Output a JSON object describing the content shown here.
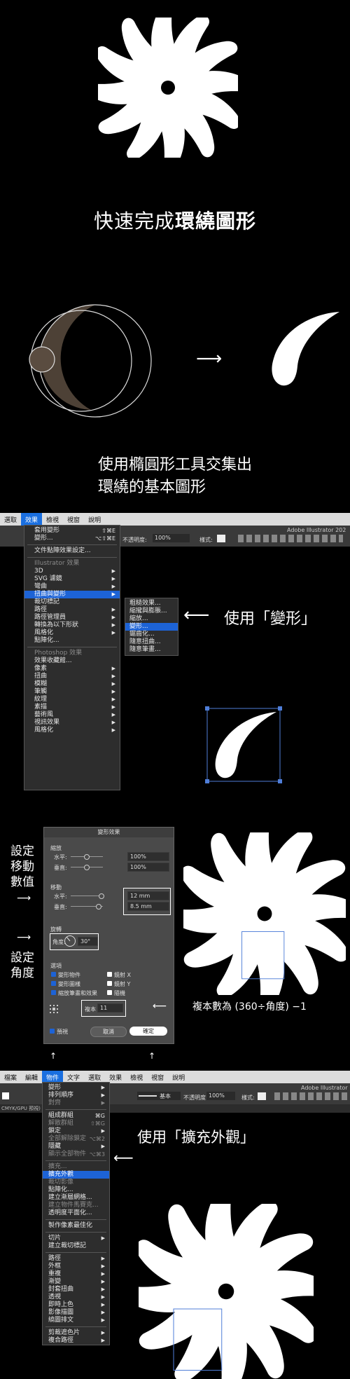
{
  "colors": {
    "accent": "#1d63d6",
    "bg": "#000000",
    "menubar": "#dcdcdc",
    "panel": "#2d2d2d"
  },
  "section1": {
    "title_regular": "快速完成",
    "title_bold": "環繞圖形"
  },
  "section2": {
    "caption_line1": "使用橢圓形工具交集出",
    "caption_line2": "環繞的基本圖形",
    "arrow": "⟶"
  },
  "section3": {
    "menubar": [
      "選取",
      "效果",
      "檢視",
      "視窗",
      "說明"
    ],
    "active_menu": "效果",
    "app_title": "Adobe Illustrator 202",
    "opacity_label": "不透明度:",
    "opacity_value": "100%",
    "style_label": "樣式:",
    "effect_menu_top": [
      {
        "label": "套用變形",
        "shortcut": "⇧⌘E"
      },
      {
        "label": "變形...",
        "shortcut": "⌥⇧⌘E"
      }
    ],
    "doc_raster": "文件點陣效果設定...",
    "illustrator_header": "Illustrator 效果",
    "illustrator_items": [
      "3D",
      "SVG 濾鏡",
      "彎曲",
      "扭曲與變形",
      "裁切標記",
      "路徑",
      "路徑管理員",
      "轉換為以下形狀",
      "風格化",
      "點陣化..."
    ],
    "photoshop_header": "Photoshop 效果",
    "photoshop_items": [
      "效果收藏館...",
      "像素",
      "扭曲",
      "模糊",
      "筆觸",
      "紋理",
      "素描",
      "藝術風",
      "視訊效果",
      "風格化"
    ],
    "submenu": [
      "粗糙效果...",
      "縮攏與膨脹...",
      "縮放...",
      "變形...",
      "鋸齒化...",
      "隨意扭曲...",
      "隨意筆畫..."
    ],
    "submenu_selected": "變形...",
    "callout": "使用「變形」"
  },
  "section4": {
    "left_label1": [
      "設定",
      "移動",
      "數值"
    ],
    "left_label2": [
      "設定",
      "角度"
    ],
    "dialog_title": "變形效果",
    "scale_header": "縮放",
    "scale_h_label": "水平:",
    "scale_h_value": "100%",
    "scale_v_label": "垂直:",
    "scale_v_value": "100%",
    "move_header": "移動",
    "move_h_label": "水平:",
    "move_h_value": "12 mm",
    "move_v_label": "垂直:",
    "move_v_value": "8.5 mm",
    "rotate_header": "旋轉",
    "angle_label": "角度:",
    "angle_value": "30°",
    "options_header": "選項",
    "options": [
      "變形物件",
      "變形圖樣",
      "縮放筆畫和效果"
    ],
    "options_right": [
      "鏡射 X",
      "鏡射 Y",
      "隨機"
    ],
    "copies_label": "複本",
    "copies_value": "11",
    "preview_label": "預視",
    "cancel": "取消",
    "ok": "確定",
    "copies_note": "複本數為 (360÷角度) −1"
  },
  "section5": {
    "menubar": [
      "檔案",
      "編輯",
      "物件",
      "文字",
      "選取",
      "效果",
      "檢視",
      "視窗",
      "說明"
    ],
    "active_menu": "物件",
    "app_title": "Adobe Illustrator",
    "doc_tab": "CMYK/GPU 預視)",
    "stroke_label": "基本",
    "opacity_label": "不透明度:",
    "opacity_value": "100%",
    "style_label": "樣式:",
    "object_menu": [
      {
        "label": "變形",
        "kind": "arrow"
      },
      {
        "label": "排列順序",
        "kind": "arrow"
      },
      {
        "label": "對齊",
        "kind": "arrow-dis"
      },
      {
        "label": "sep"
      },
      {
        "label": "組成群組",
        "kind": "sc",
        "sc": "⌘G"
      },
      {
        "label": "解散群組",
        "kind": "sc-dis",
        "sc": "⇧⌘G"
      },
      {
        "label": "鎖定",
        "kind": "arrow"
      },
      {
        "label": "全部解除鎖定",
        "kind": "sc-dis",
        "sc": "⌥⌘2"
      },
      {
        "label": "隱藏",
        "kind": "arrow"
      },
      {
        "label": "顯示全部物件",
        "kind": "sc-dis",
        "sc": "⌥⌘3"
      },
      {
        "label": "sep"
      },
      {
        "label": "擴充...",
        "kind": "dis"
      },
      {
        "label": "擴充外觀",
        "kind": "sel"
      },
      {
        "label": "裁切影像",
        "kind": "dis"
      },
      {
        "label": "點陣化..."
      },
      {
        "label": "建立漸層網格..."
      },
      {
        "label": "建立物件馬賽克...",
        "kind": "dis"
      },
      {
        "label": "透明度平面化..."
      },
      {
        "label": "sep"
      },
      {
        "label": "製作像素最佳化"
      },
      {
        "label": "sep"
      },
      {
        "label": "切片",
        "kind": "arrow"
      },
      {
        "label": "建立裁切標記"
      },
      {
        "label": "sep"
      },
      {
        "label": "路徑",
        "kind": "arrow"
      },
      {
        "label": "外框",
        "kind": "arrow"
      },
      {
        "label": "重複",
        "kind": "arrow"
      },
      {
        "label": "漸變",
        "kind": "arrow"
      },
      {
        "label": "封套扭曲",
        "kind": "arrow"
      },
      {
        "label": "透視",
        "kind": "arrow"
      },
      {
        "label": "即時上色",
        "kind": "arrow"
      },
      {
        "label": "影像描圖",
        "kind": "arrow"
      },
      {
        "label": "繞圖排文",
        "kind": "arrow"
      },
      {
        "label": "sep"
      },
      {
        "label": "剪裁遮色片",
        "kind": "arrow"
      },
      {
        "label": "複合路徑",
        "kind": "arrow"
      }
    ],
    "callout": "使用「擴充外觀」"
  }
}
